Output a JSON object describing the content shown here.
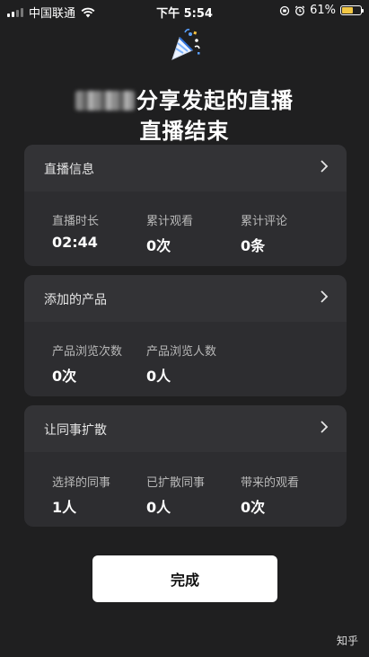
{
  "status_bar": {
    "carrier": "中国联通",
    "time": "下午 5:54",
    "battery": "61%",
    "battery_level": 0.61
  },
  "header": {
    "title_suffix": "分享发起的直播",
    "subtitle": "直播结束"
  },
  "cards": [
    {
      "title": "直播信息",
      "stats": [
        {
          "label": "直播时长",
          "value": "02:44"
        },
        {
          "label": "累计观看",
          "value": "0次"
        },
        {
          "label": "累计评论",
          "value": "0条"
        }
      ]
    },
    {
      "title": "添加的产品",
      "stats": [
        {
          "label": "产品浏览次数",
          "value": "0次"
        },
        {
          "label": "产品浏览人数",
          "value": "0人"
        }
      ]
    },
    {
      "title": "让同事扩散",
      "stats": [
        {
          "label": "选择的同事",
          "value": "1人"
        },
        {
          "label": "已扩散同事",
          "value": "0人"
        },
        {
          "label": "带来的观看",
          "value": "0次"
        }
      ]
    }
  ],
  "done_button": "完成",
  "watermark": "知乎"
}
